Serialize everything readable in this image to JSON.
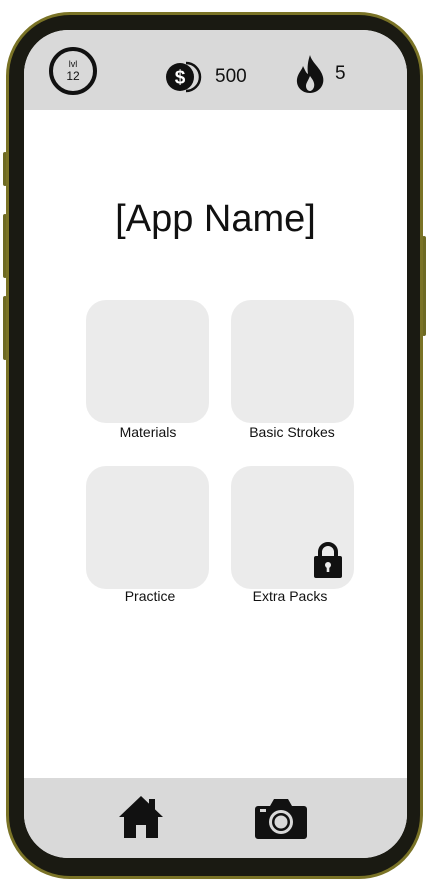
{
  "header": {
    "level_label": "lvl",
    "level_number": "12",
    "coin_icon": "dollar-coin-icon",
    "coins": "500",
    "streak_icon": "flame-icon",
    "streak": "5"
  },
  "main": {
    "app_name": "[App Name]",
    "tiles": [
      {
        "label": "Materials",
        "locked": false
      },
      {
        "label": "Basic Strokes",
        "locked": false
      },
      {
        "label": "Practice",
        "locked": false
      },
      {
        "label": "Extra Packs",
        "locked": true
      }
    ]
  },
  "bottom_nav": {
    "items": [
      {
        "icon": "home-icon"
      },
      {
        "icon": "camera-icon"
      }
    ]
  },
  "colors": {
    "bar_background": "#d9d9d9",
    "tile_background": "#ebebeb",
    "frame_accent": "#7a7326",
    "ink": "#111111"
  }
}
